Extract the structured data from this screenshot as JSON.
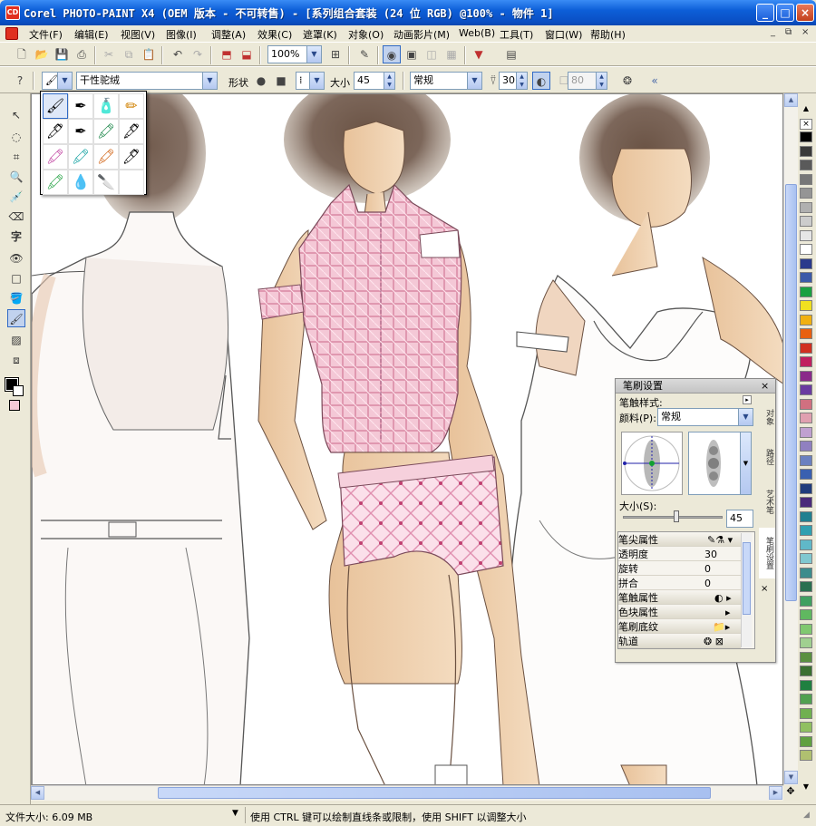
{
  "window": {
    "title": "Corel PHOTO-PAINT X4 (OEM 版本 - 不可转售) - [系列组合套装 (24 位 RGB) @100% - 物件 1]",
    "app_icon_text": "CD",
    "min_label": "_",
    "max_label": "□",
    "close_label": "×"
  },
  "menu": {
    "items": [
      "文件(F)",
      "编辑(E)",
      "视图(V)",
      "图像(I)",
      "调整(A)",
      "效果(C)",
      "遮罩(K)",
      "对象(O)",
      "动画影片(M)",
      "Web(B)",
      "工具(T)",
      "窗口(W)",
      "帮助(H)"
    ],
    "mdi_minimize": "_",
    "mdi_restore": "⧉",
    "mdi_close": "×"
  },
  "toolbar1": {
    "zoom_value": "100%"
  },
  "toolbar2": {
    "brush_name": "干性驼绒",
    "shape_label": "形状",
    "size_label": "大小",
    "size_value": "45",
    "mode_value": "常规",
    "transparency_value": "30",
    "opacity_value": "80"
  },
  "brush_panel": {
    "title": "笔刷设置",
    "style_label": "笔触样式:",
    "paint_label": "颜料(P):",
    "paint_value": "常规",
    "size_label": "大小(S):",
    "size_value": "45",
    "rows": [
      {
        "label": "笔尖属性",
        "value": "",
        "header": true
      },
      {
        "label": "透明度",
        "value": "30",
        "header": false
      },
      {
        "label": "旋转",
        "value": "0",
        "header": false
      },
      {
        "label": "拼合",
        "value": "0",
        "header": false
      },
      {
        "label": "笔触属性",
        "value": "",
        "header": true
      },
      {
        "label": "色块属性",
        "value": "",
        "header": true
      },
      {
        "label": "笔刷底纹",
        "value": "",
        "header": true
      },
      {
        "label": "轨道",
        "value": "",
        "header": true
      }
    ],
    "side_tabs": [
      "对象",
      "路径",
      "艺术笔",
      "笔刷设置"
    ]
  },
  "status": {
    "file_size": "文件大小: 6.09 MB",
    "hint": "使用 CTRL 键可以绘制直线条或限制，使用 SHIFT 以调整大小"
  },
  "palette": {
    "colors": [
      "#000000",
      "#3a3a3a",
      "#5a5a5a",
      "#777777",
      "#959595",
      "#b0b0b0",
      "#cccccc",
      "#e6e6e6",
      "#ffffff",
      "#2a3a8c",
      "#3c5aa8",
      "#1aa040",
      "#f0e020",
      "#f0b010",
      "#e86010",
      "#d03020",
      "#c02060",
      "#8a2a8a",
      "#6a3aa0",
      "#d07080",
      "#e0a0b0",
      "#c0a0d0",
      "#9080c0",
      "#6a80c0",
      "#3a60b0",
      "#203c7c",
      "#4a2a7a",
      "#208090",
      "#30a0b0",
      "#60b8c8",
      "#80c8d0",
      "#3c8c8c",
      "#2a7050",
      "#40a060",
      "#60b860",
      "#80c870",
      "#a0d090",
      "#5a9040",
      "#3a7030",
      "#208040",
      "#50a050",
      "#70b050",
      "#90c060",
      "#60a040",
      "#b0c070"
    ]
  }
}
